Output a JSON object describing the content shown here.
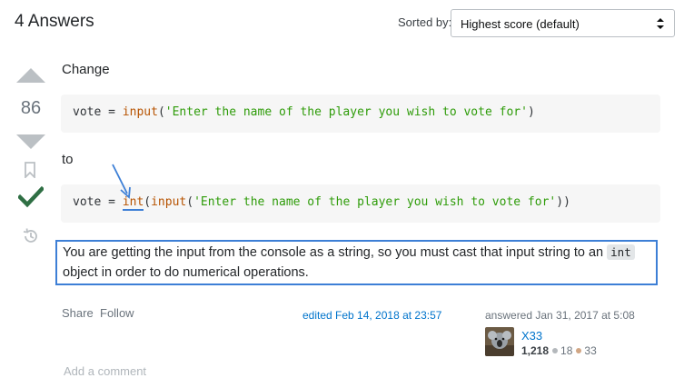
{
  "header": {
    "answers_count": "4 Answers",
    "sorted_label": "Sorted by:",
    "sort_value": "Highest score (default)"
  },
  "votes": {
    "score": "86"
  },
  "post": {
    "p1": "Change",
    "code1": {
      "prefix": "vote = ",
      "fn": "input",
      "open": "(",
      "str": "'Enter the name of the player you wish to vote for'",
      "close": ")"
    },
    "p2": "to",
    "code2": {
      "prefix": "vote = ",
      "fn_outer": "int",
      "open_outer": "(",
      "fn_inner": "input",
      "open_inner": "(",
      "str": "'Enter the name of the player you wish to vote for'",
      "close": "))"
    },
    "explain_before": "You are getting the input from the console as a string, so you must cast that input string to an ",
    "explain_code": "int",
    "explain_after": " object in order to do numerical operations."
  },
  "footer": {
    "share": "Share",
    "follow": "Follow",
    "edited": "edited Feb 14, 2018 at 23:57",
    "answered": "answered Jan 31, 2017 at 5:08",
    "user": {
      "name": "X33",
      "reputation": "1,218",
      "silver": "18",
      "bronze": "33"
    },
    "add_comment": "Add a comment"
  },
  "colors": {
    "accent_link": "#0074cc",
    "accepted_check": "#2f6f44",
    "annotation": "#3d7fd6",
    "silver_badge": "#b4b8bc",
    "bronze_badge": "#d1a684"
  }
}
